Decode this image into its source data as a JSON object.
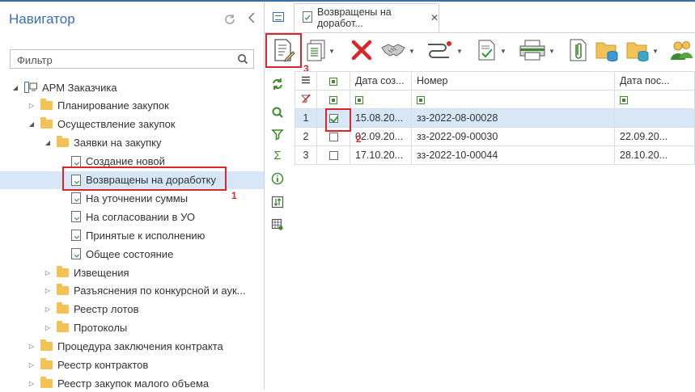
{
  "navigator": {
    "title": "Навигатор",
    "filter_placeholder": "Фильтр",
    "tree": [
      {
        "label": "АРМ Заказчика",
        "kind": "root",
        "level": 0,
        "state": "expanded"
      },
      {
        "label": "Планирование закупок",
        "kind": "folder",
        "level": 1,
        "state": "collapsed"
      },
      {
        "label": "Осуществление закупок",
        "kind": "folder",
        "level": 1,
        "state": "expanded"
      },
      {
        "label": "Заявки на закупку",
        "kind": "folder",
        "level": 2,
        "state": "expanded"
      },
      {
        "label": "Создание новой",
        "kind": "doc",
        "level": 3
      },
      {
        "label": "Возвращены на доработку",
        "kind": "doc",
        "level": 3,
        "selected": true
      },
      {
        "label": "На уточнении суммы",
        "kind": "doc",
        "level": 3
      },
      {
        "label": "На согласовании в УО",
        "kind": "doc",
        "level": 3
      },
      {
        "label": "Принятые к исполнению",
        "kind": "doc",
        "level": 3
      },
      {
        "label": "Общее состояние",
        "kind": "doc",
        "level": 3
      },
      {
        "label": "Извещения",
        "kind": "folder",
        "level": 2,
        "state": "collapsed"
      },
      {
        "label": "Разъяснения по конкурсной и аук...",
        "kind": "folder",
        "level": 2,
        "state": "collapsed"
      },
      {
        "label": "Реестр лотов",
        "kind": "folder",
        "level": 2,
        "state": "collapsed"
      },
      {
        "label": "Протоколы",
        "kind": "folder",
        "level": 2,
        "state": "collapsed"
      },
      {
        "label": "Процедура заключения контракта",
        "kind": "folder",
        "level": 1,
        "state": "collapsed"
      },
      {
        "label": "Реестр контрактов",
        "kind": "folder",
        "level": 1,
        "state": "collapsed"
      },
      {
        "label": "Реестр закупок малого объема",
        "kind": "folder",
        "level": 1,
        "state": "collapsed"
      }
    ]
  },
  "tab": {
    "label": "Возвращены на доработ..."
  },
  "toolbar": {
    "buttons": [
      "edit-document",
      "document-list",
      "delete",
      "handshake",
      "route",
      "document-check",
      "print",
      "attachments",
      "folder-db",
      "folder-db-2",
      "users"
    ]
  },
  "grid": {
    "columns": [
      "Дата соз...",
      "Номер",
      "Дата пос..."
    ],
    "rows": [
      {
        "n": "1",
        "checked": true,
        "date": "15.08.20...",
        "number": "зз-2022-08-00028",
        "date2": ""
      },
      {
        "n": "2",
        "checked": false,
        "date": "02.09.20...",
        "number": "зз-2022-09-00030",
        "date2": "22.09.20..."
      },
      {
        "n": "3",
        "checked": false,
        "date": "17.10.20...",
        "number": "зз-2022-10-00044",
        "date2": "28.10.20..."
      }
    ]
  },
  "annotations": {
    "mark1": "1",
    "mark2": "2",
    "mark3": "3"
  },
  "colors": {
    "accent": "#3a6fb0",
    "highlight": "#d8262b",
    "selection": "#d7e7f7"
  }
}
